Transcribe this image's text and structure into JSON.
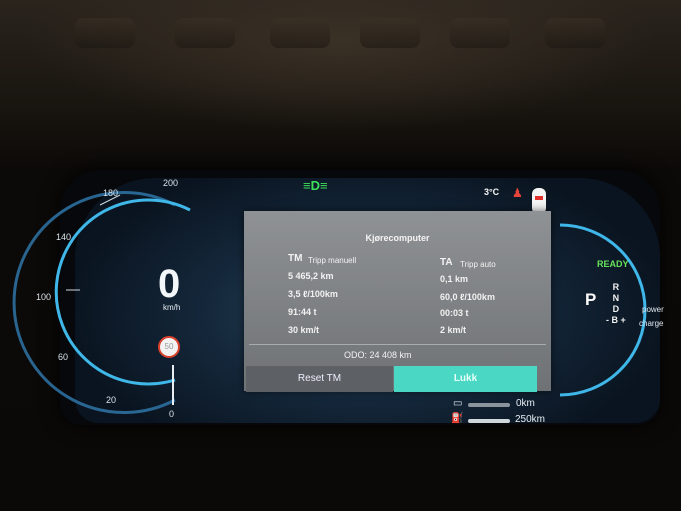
{
  "speedometer": {
    "ticks": [
      "200",
      "180",
      "140",
      "100",
      "60",
      "20",
      "0"
    ],
    "speed": "0",
    "unit": "km/h",
    "limit_sign": "50"
  },
  "trip_panel": {
    "title": "Kjørecomputer",
    "tm": {
      "code": "TM",
      "name": "Tripp manuell",
      "distance": "5 465,2 km",
      "consumption": "3,5 ℓ/100km",
      "time": "91:44 t",
      "speed": "30 km/t"
    },
    "ta": {
      "code": "TA",
      "name": "Tripp auto",
      "distance": "0,1 km",
      "consumption": "60,0 ℓ/100km",
      "time": "00:03 t",
      "speed": "2 km/t"
    },
    "odometer": "ODO: 24 408 km",
    "reset_button": "Reset TM",
    "close_button": "Lukk"
  },
  "status": {
    "headlight_icon": "headlight-icon",
    "temperature": "3°C",
    "ready": "READY",
    "gear": "P",
    "gears": [
      "R",
      "N",
      "D",
      "- B +"
    ],
    "power_label": "power",
    "charge_label": "charge",
    "fuel_range": "0km",
    "electric_range": "250km"
  },
  "colors": {
    "ready_green": "#68e35c",
    "accent_teal": "#4ad8c4",
    "warning_red": "#e3312b"
  }
}
